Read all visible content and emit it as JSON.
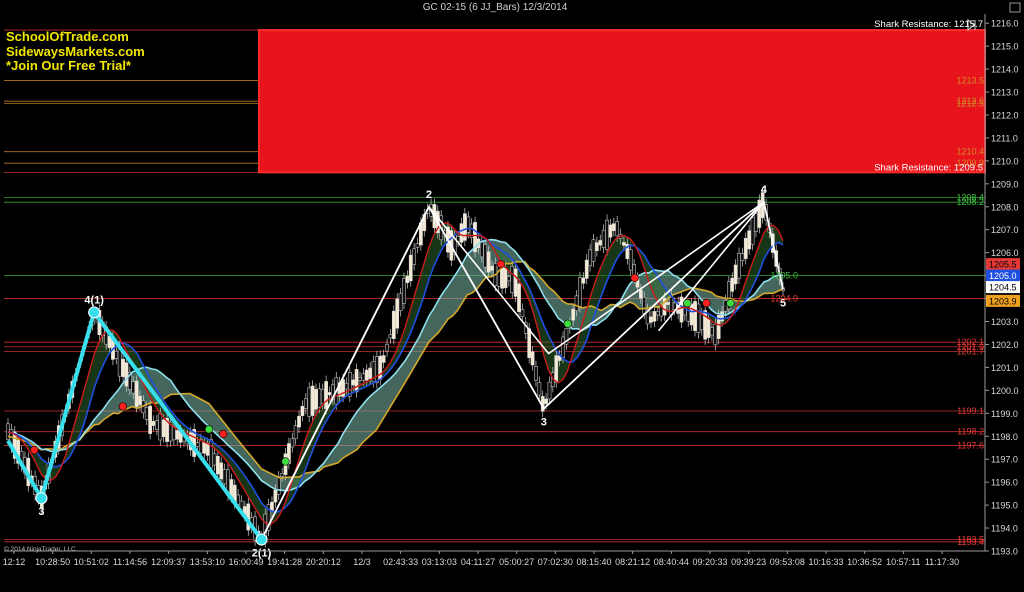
{
  "window_title": "GC 02-15 (6 JJ_Bars)  12/3/2014",
  "branding": [
    "SchoolOfTrade.com",
    "SidewaysMarkets.com",
    "*Join Our Free Trial*"
  ],
  "copyright": "© 2014 NinjaTrader, LLC",
  "colors": {
    "background": "#000000",
    "resistance_zone": "#e8141c",
    "brand_text": "#f2e600",
    "support_level": "#e53935",
    "resistance_level": "#3fbf3f",
    "orange_level": "#d48a2a",
    "cyan_swing": "#38e0ee",
    "white_swing": "#ffffff",
    "ema_red": "#cc1a1a",
    "ema_blue": "#1e4fe0",
    "ema_cyan": "#8fe0ee",
    "ema_gold": "#d4a82a"
  },
  "chart_data": {
    "type": "candlestick",
    "instrument": "GC 02-15",
    "y_axis": {
      "min": 1193.0,
      "max": 1216.4,
      "ticks": [
        1193.0,
        1194.0,
        1195.0,
        1196.0,
        1197.0,
        1198.0,
        1199.0,
        1200.0,
        1201.0,
        1202.0,
        1203.0,
        1204.0,
        1205.0,
        1206.0,
        1207.0,
        1208.0,
        1209.0,
        1210.0,
        1211.0,
        1212.0,
        1213.0,
        1214.0,
        1215.0,
        1216.0
      ],
      "tick_labels": [
        "1193.0",
        "1194.0",
        "1195.0",
        "1196.0",
        "1197.0",
        "1198.0",
        "1199.0",
        "1200.0",
        "1201.0",
        "1202.0",
        "1203.0",
        "1204.0",
        "1205.0",
        "1206.0",
        "1207.0",
        "1208.0",
        "1209.0",
        "1210.0",
        "1211.0",
        "1212.0",
        "1213.0",
        "1214.0",
        "1215.0",
        "1216.0"
      ]
    },
    "x_axis": {
      "labels": [
        "12:12",
        "10:28:50",
        "10:51:02",
        "11:14:56",
        "12:09:37",
        "13:53:10",
        "16:00:49",
        "19:41:28",
        "20:20:12",
        "12/3",
        "02:43:33",
        "03:13:03",
        "04:11:27",
        "05:00:27",
        "07:02:30",
        "08:15:40",
        "08:21:12",
        "08:40:44",
        "09:20:33",
        "09:39:23",
        "09:53:08",
        "10:16:33",
        "10:36:52",
        "10:57:11",
        "11:17:30"
      ]
    },
    "resistance_zone": {
      "low": 1209.5,
      "high": 1215.7
    },
    "shark_labels": [
      {
        "text": "Shark Resistance: 1215.7",
        "price": 1215.7
      },
      {
        "text": "Shark Resistance: 1209.5",
        "price": 1209.5
      }
    ],
    "levels": [
      {
        "price": 1215.7,
        "color": "red",
        "label": ""
      },
      {
        "price": 1213.5,
        "color": "orange",
        "label": "1213.5"
      },
      {
        "price": 1212.6,
        "color": "orange",
        "label": "1212.6"
      },
      {
        "price": 1212.5,
        "color": "orange",
        "label": "1212.5"
      },
      {
        "price": 1210.4,
        "color": "orange",
        "label": "1210.4"
      },
      {
        "price": 1209.9,
        "color": "orange",
        "label": "1209.9"
      },
      {
        "price": 1209.5,
        "color": "red",
        "label": ""
      },
      {
        "price": 1208.4,
        "color": "green",
        "label": "1208.4"
      },
      {
        "price": 1208.2,
        "color": "green",
        "label": "1208.2"
      },
      {
        "price": 1205.0,
        "color": "green",
        "label": "1205.0"
      },
      {
        "price": 1204.0,
        "color": "red",
        "label": "1204.0"
      },
      {
        "price": 1202.1,
        "color": "red",
        "label": "1202.1"
      },
      {
        "price": 1201.9,
        "color": "red",
        "label": "1201.9"
      },
      {
        "price": 1201.7,
        "color": "red",
        "label": "1201.7"
      },
      {
        "price": 1199.1,
        "color": "red",
        "label": "1199.1"
      },
      {
        "price": 1198.2,
        "color": "red",
        "label": "1198.2"
      },
      {
        "price": 1197.6,
        "color": "red",
        "label": "1197.6"
      },
      {
        "price": 1193.5,
        "color": "red",
        "label": "1193.5"
      },
      {
        "price": 1193.4,
        "color": "red",
        "label": "1193.4"
      }
    ],
    "price_markers": [
      {
        "price": 1205.5,
        "label": "1205.5",
        "bg": "#e53935",
        "fg": "#000000"
      },
      {
        "price": 1205.0,
        "label": "1205.0",
        "bg": "#1e4fe0",
        "fg": "#ffffff"
      },
      {
        "price": 1204.5,
        "label": "1204.5",
        "bg": "#ffffff",
        "fg": "#000000"
      },
      {
        "price": 1203.9,
        "label": "1203.9",
        "bg": "#f0a020",
        "fg": "#000000"
      }
    ],
    "swing_cyan": [
      {
        "bar": 0.0,
        "price": 1197.8
      },
      {
        "bar": 0.07,
        "price": 1195.3,
        "label": "3"
      },
      {
        "bar": 0.18,
        "price": 1203.4,
        "label": "4(1)"
      },
      {
        "bar": 0.53,
        "price": 1193.5,
        "label": "2(1)"
      }
    ],
    "swing_white": [
      {
        "bar": 0.53,
        "price": 1193.5
      },
      {
        "bar": 0.88,
        "price": 1208.0,
        "label": "2"
      },
      {
        "bar": 1.12,
        "price": 1199.2,
        "label": "3"
      },
      {
        "bar": 1.58,
        "price": 1208.2,
        "label": "4"
      },
      {
        "bar": 1.62,
        "price": 1204.4,
        "label": "5"
      }
    ],
    "swing_white_side": [
      {
        "bar": 0.53,
        "price": 1193.5
      },
      {
        "bar": 0.88,
        "price": 1208.0
      },
      {
        "bar": 1.13,
        "price": 1201.6
      },
      {
        "bar": 1.58,
        "price": 1208.2
      },
      {
        "bar": 1.36,
        "price": 1202.6
      }
    ],
    "signal_dots": [
      {
        "bar": 0.055,
        "price": 1197.4,
        "color": "red"
      },
      {
        "bar": 0.24,
        "price": 1199.3,
        "color": "red"
      },
      {
        "bar": 0.42,
        "price": 1198.3,
        "color": "green"
      },
      {
        "bar": 0.45,
        "price": 1198.1,
        "color": "red"
      },
      {
        "bar": 0.58,
        "price": 1196.9,
        "color": "green"
      },
      {
        "bar": 1.03,
        "price": 1205.5,
        "color": "red"
      },
      {
        "bar": 1.17,
        "price": 1202.9,
        "color": "green"
      },
      {
        "bar": 1.31,
        "price": 1204.9,
        "color": "red"
      },
      {
        "bar": 1.42,
        "price": 1203.8,
        "color": "green"
      },
      {
        "bar": 1.46,
        "price": 1203.8,
        "color": "red"
      },
      {
        "bar": 1.51,
        "price": 1203.8,
        "color": "green"
      }
    ]
  }
}
